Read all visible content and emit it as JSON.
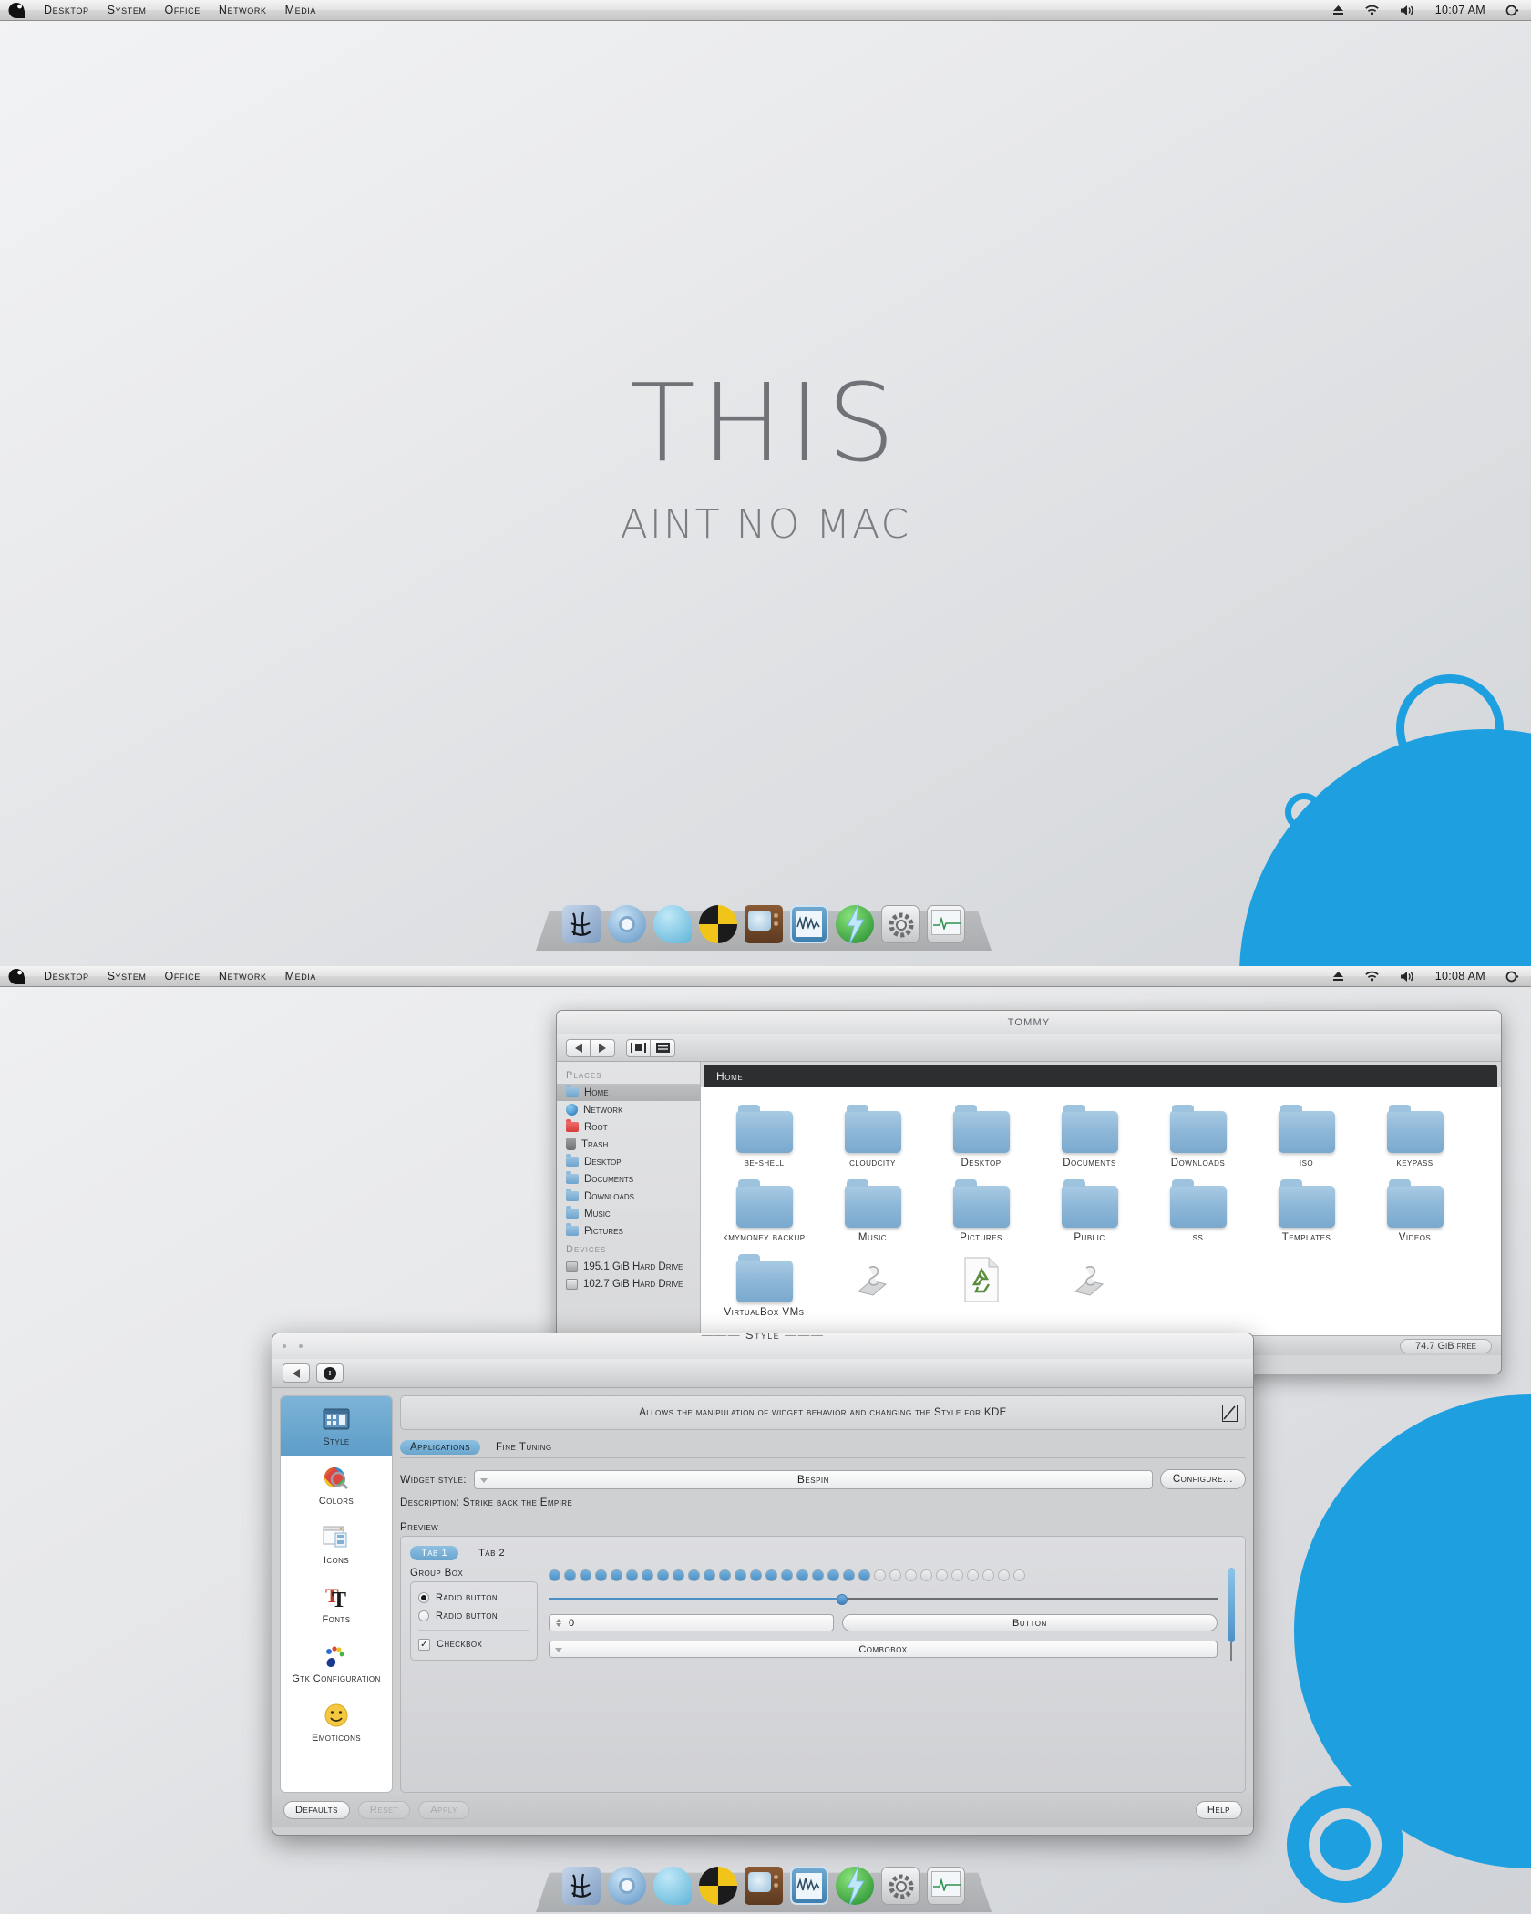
{
  "menubar_top": {
    "logo": "dark-logo-icon",
    "items": [
      "Desktop",
      "System",
      "Office",
      "Network",
      "Media"
    ],
    "tray": [
      "eject-icon",
      "wifi-icon",
      "volume-icon"
    ],
    "time": "10:07 AM",
    "power": "power-icon"
  },
  "menubar_bottom": {
    "logo": "dark-logo-icon",
    "items": [
      "Desktop",
      "System",
      "Office",
      "Network",
      "Media"
    ],
    "tray": [
      "eject-icon",
      "wifi-icon",
      "volume-icon"
    ],
    "time": "10:08 AM",
    "power": "power-icon"
  },
  "wallpaper": {
    "title": "THIS",
    "subtitle": "AINT NO MAC",
    "accent": "#1e9fe0"
  },
  "dock": {
    "items": [
      {
        "name": "finder",
        "icon": "finder-face-icon"
      },
      {
        "name": "chrome",
        "icon": "chrome-browser-icon"
      },
      {
        "name": "messenger",
        "icon": "chat-bubble-icon"
      },
      {
        "name": "brasero",
        "icon": "burn-disc-icon"
      },
      {
        "name": "tv",
        "icon": "television-icon"
      },
      {
        "name": "audio-editor",
        "icon": "waveform-monitor-icon"
      },
      {
        "name": "energy",
        "icon": "lightning-bolt-icon"
      },
      {
        "name": "settings",
        "icon": "gear-icon"
      },
      {
        "name": "system-monitor",
        "icon": "heartbeat-monitor-icon"
      }
    ]
  },
  "file_manager": {
    "title": "TOMMY",
    "toolbar": {
      "back": "back-arrow-icon",
      "forward": "forward-arrow-icon",
      "split": "split-view-icon",
      "menu": "menu-icon"
    },
    "breadcrumb": "Home",
    "places_header": "Places",
    "places": [
      {
        "label": "Home",
        "icon": "home-folder-icon",
        "selected": true
      },
      {
        "label": "Network",
        "icon": "globe-icon",
        "selected": false
      },
      {
        "label": "Root",
        "icon": "red-folder-icon",
        "selected": false
      },
      {
        "label": "Trash",
        "icon": "trash-icon",
        "selected": false
      },
      {
        "label": "Desktop",
        "icon": "folder-icon",
        "selected": false
      },
      {
        "label": "Documents",
        "icon": "folder-icon",
        "selected": false
      },
      {
        "label": "Downloads",
        "icon": "folder-icon",
        "selected": false
      },
      {
        "label": "Music",
        "icon": "folder-icon",
        "selected": false
      },
      {
        "label": "Pictures",
        "icon": "folder-icon",
        "selected": false
      }
    ],
    "devices_header": "Devices",
    "devices": [
      {
        "label": "195.1 GiB Hard Drive",
        "icon": "harddrive-mounted-icon"
      },
      {
        "label": "102.7 GiB Hard Drive",
        "icon": "harddrive-icon"
      }
    ],
    "files": [
      [
        {
          "label": "be-shell",
          "icon": "folder-icon",
          "link": true
        },
        {
          "label": "cloudcity",
          "icon": "folder-icon",
          "link": false
        },
        {
          "label": "Desktop",
          "icon": "folder-icon",
          "link": false
        },
        {
          "label": "Documents",
          "icon": "folder-icon",
          "link": false
        },
        {
          "label": "Downloads",
          "icon": "folder-icon",
          "link": false
        },
        {
          "label": "iso",
          "icon": "folder-icon",
          "link": false
        },
        {
          "label": "keypass",
          "icon": "folder-icon",
          "link": false
        }
      ],
      [
        {
          "label": "kmymoney backup",
          "icon": "folder-icon",
          "link": false
        },
        {
          "label": "Music",
          "icon": "folder-icon",
          "link": false
        },
        {
          "label": "Pictures",
          "icon": "folder-icon",
          "link": false
        },
        {
          "label": "Public",
          "icon": "folder-icon",
          "link": false
        },
        {
          "label": "ss",
          "icon": "folder-icon",
          "link": false
        },
        {
          "label": "Templates",
          "icon": "folder-icon",
          "link": false
        },
        {
          "label": "Videos",
          "icon": "folder-icon",
          "link": false
        }
      ],
      [
        {
          "label": "VirtualBox VMs",
          "icon": "folder-icon",
          "link": false
        },
        {
          "label": "",
          "icon": "script-icon",
          "link": false
        },
        {
          "label": "",
          "icon": "recycle-document-icon",
          "link": false
        },
        {
          "label": "",
          "icon": "script-icon",
          "link": false
        }
      ]
    ],
    "status": "74.7 GiB free"
  },
  "style_window": {
    "title": "Style",
    "toolbar": {
      "back": "back-arrow-icon",
      "info": "info-icon"
    },
    "sidebar": [
      {
        "label": "Style",
        "icon": "widget-style-icon",
        "selected": true
      },
      {
        "label": "Colors",
        "icon": "color-wheel-icon",
        "selected": false
      },
      {
        "label": "Icons",
        "icon": "icons-window-icon",
        "selected": false
      },
      {
        "label": "Fonts",
        "icon": "font-T-icon",
        "selected": false
      },
      {
        "label": "Gtk Configuration",
        "icon": "gtk-foot-icon",
        "selected": false
      },
      {
        "label": "Emoticons",
        "icon": "smiley-icon",
        "selected": false
      }
    ],
    "description_banner": "Allows the manipulation of widget behavior and changing the Style for KDE",
    "banner_icon": "pencil-edit-icon",
    "tabs": [
      {
        "label": "Applications",
        "active": true
      },
      {
        "label": "Fine Tuning",
        "active": false
      }
    ],
    "widget_style_label": "Widget style:",
    "widget_style_value": "Bespin",
    "configure_button": "Configure...",
    "style_description": "Description: Strike back the Empire",
    "preview_label": "Preview",
    "preview": {
      "tabs": [
        {
          "label": "Tab 1",
          "active": true
        },
        {
          "label": "Tab 2",
          "active": false
        }
      ],
      "group_box_label": "Group Box",
      "radio1": "Radio button",
      "radio2": "Radio button",
      "radio1_selected": true,
      "radio2_selected": false,
      "checkbox_label": "Checkbox",
      "checkbox_checked": true,
      "progress_dots_total": 31,
      "progress_dots_filled": 21,
      "slider_value_pct": 43,
      "spinbox_value": "0",
      "button_label": "Button",
      "combobox_label": "Combobox",
      "vertical_slider_pct": 82
    },
    "footer": {
      "defaults": "Defaults",
      "reset": "Reset",
      "apply": "Apply",
      "help": "Help",
      "reset_disabled": true,
      "apply_disabled": true
    }
  }
}
